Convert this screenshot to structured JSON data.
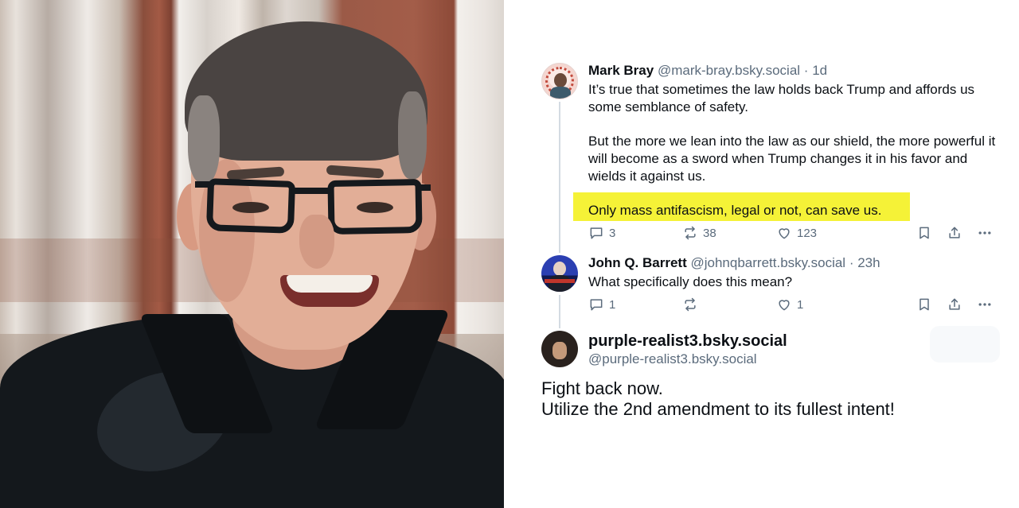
{
  "thread": {
    "post1": {
      "display_name": "Mark Bray",
      "handle": "@mark-bray.bsky.social",
      "separator": "·",
      "time": "1d",
      "paragraph1": "It’s true that sometimes the law holds back Trump and affords us some semblance of safety.",
      "paragraph2": "But the more we lean into the law as our shield, the more powerful it will become as a sword when Trump changes it in his favor and wields it against us.",
      "paragraph3": "Only mass antifascism, legal or not, can save us.",
      "highlight_color": "#f5f237",
      "replies": "3",
      "reposts": "38",
      "likes": "123"
    },
    "post2": {
      "display_name": "John Q. Barrett",
      "handle": "@johnqbarrett.bsky.social",
      "separator": "·",
      "time": "23h",
      "text": "What specifically does this mean?",
      "replies": "1",
      "reposts": "",
      "likes": "1"
    },
    "post3": {
      "display_name": "purple-realist3.bsky.social",
      "handle": "@purple-realist3.bsky.social",
      "line1": "Fight back now.",
      "line2": "Utilize the 2nd amendment to its fullest intent!"
    }
  },
  "icons": [
    "reply-icon",
    "repost-icon",
    "like-icon",
    "bookmark-icon",
    "share-icon",
    "more-icon"
  ],
  "colors": {
    "text": "#0b0f14",
    "muted": "#5b6b7c",
    "thread_line": "#d4dbe2"
  }
}
